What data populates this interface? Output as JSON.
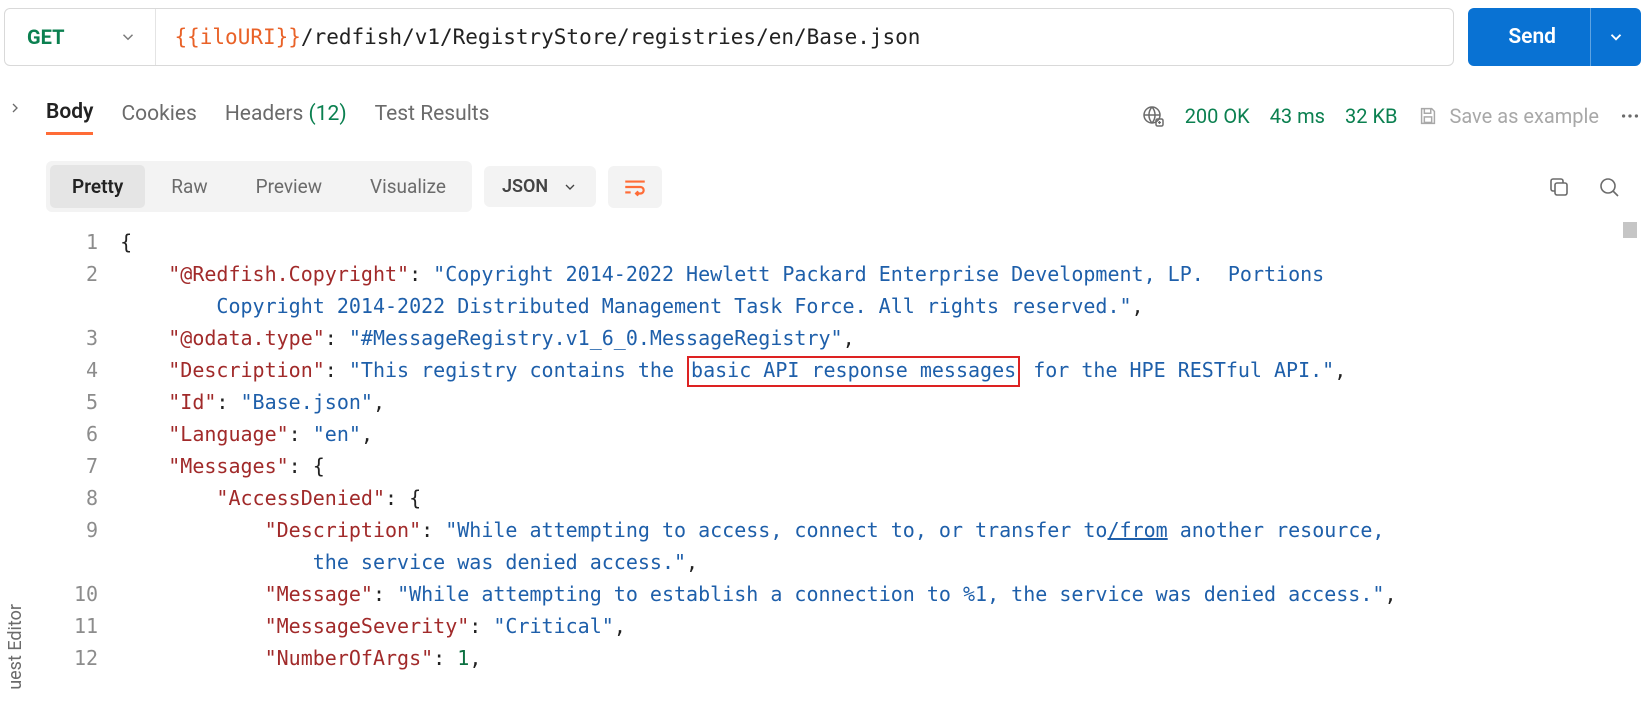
{
  "request": {
    "method": "GET",
    "url_var": "{{iloURI}}",
    "url_path": "/redfish/v1/RegistryStore/registries/en/Base.json",
    "send_label": "Send"
  },
  "response_tabs": {
    "body": "Body",
    "cookies": "Cookies",
    "headers_label": "Headers",
    "headers_count": "(12)",
    "test_results": "Test Results"
  },
  "status": {
    "code": "200 OK",
    "time": "43 ms",
    "size": "32 KB",
    "save_label": "Save as example"
  },
  "view": {
    "pretty": "Pretty",
    "raw": "Raw",
    "preview": "Preview",
    "visualize": "Visualize",
    "format": "JSON"
  },
  "left_rail_label": "uest Editor",
  "code_lines": {
    "l1": "{",
    "l2a": "    \"@Redfish.Copyright\"",
    "l2b": ": ",
    "l2c": "\"Copyright 2014-2022 Hewlett Packard Enterprise Development, LP.  Portions ",
    "l2d": "        Copyright 2014-2022 Distributed Management Task Force. All rights reserved.\"",
    "l2e": ",",
    "l3a": "    \"@odata.type\"",
    "l3b": ": ",
    "l3c": "\"#MessageRegistry.v1_6_0.MessageRegistry\"",
    "l3d": ",",
    "l4a": "    \"Description\"",
    "l4b": ": ",
    "l4c1": "\"This registry contains the ",
    "l4c2": "basic API response messages",
    "l4c3": " for the HPE RESTful API.\"",
    "l4d": ",",
    "l5a": "    \"Id\"",
    "l5b": ": ",
    "l5c": "\"Base.json\"",
    "l5d": ",",
    "l6a": "    \"Language\"",
    "l6b": ": ",
    "l6c": "\"en\"",
    "l6d": ",",
    "l7a": "    \"Messages\"",
    "l7b": ": {",
    "l8a": "        \"AccessDenied\"",
    "l8b": ": {",
    "l9a": "            \"Description\"",
    "l9b": ": ",
    "l9c1": "\"While attempting to access, connect to, or transfer to",
    "l9c2": "/from",
    "l9c3": " another resource, ",
    "l9d": "                the service was denied access.\"",
    "l9e": ",",
    "l10a": "            \"Message\"",
    "l10b": ": ",
    "l10c": "\"While attempting to establish a connection to %1, the service was denied access.\"",
    "l10d": ",",
    "l11a": "            \"MessageSeverity\"",
    "l11b": ": ",
    "l11c": "\"Critical\"",
    "l11d": ",",
    "l12a": "            \"NumberOfArgs\"",
    "l12b": ": ",
    "l12c": "1",
    "l12d": ","
  },
  "line_numbers": [
    "1",
    "2",
    "",
    "3",
    "4",
    "5",
    "6",
    "7",
    "8",
    "9",
    "",
    "10",
    "11",
    "12"
  ]
}
